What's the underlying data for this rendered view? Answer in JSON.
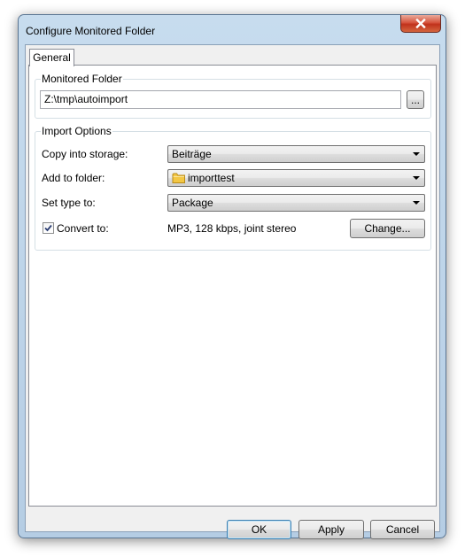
{
  "window": {
    "title": "Configure Monitored Folder"
  },
  "tabs": [
    {
      "label": "General",
      "selected": true
    }
  ],
  "monitored_folder": {
    "group_label": "Monitored Folder",
    "path": "Z:\\tmp\\autoimport",
    "browse_label": "..."
  },
  "import_options": {
    "group_label": "Import Options",
    "copy_into_storage": {
      "label": "Copy into storage:",
      "value": "Beiträge"
    },
    "add_to_folder": {
      "label": "Add to folder:",
      "value": "importtest",
      "icon": "folder-icon"
    },
    "set_type_to": {
      "label": "Set type to:",
      "value": "Package"
    },
    "convert_to": {
      "label": "Convert to:",
      "checked": true,
      "value": "MP3, 128 kbps, joint stereo",
      "change_label": "Change..."
    }
  },
  "footer": {
    "ok_label": "OK",
    "apply_label": "Apply",
    "cancel_label": "Cancel"
  },
  "colors": {
    "frame": "#b5cde4",
    "close_button": "#c94a31",
    "default_button_border": "#3c7fb1",
    "folder_icon": "#f3c744"
  }
}
